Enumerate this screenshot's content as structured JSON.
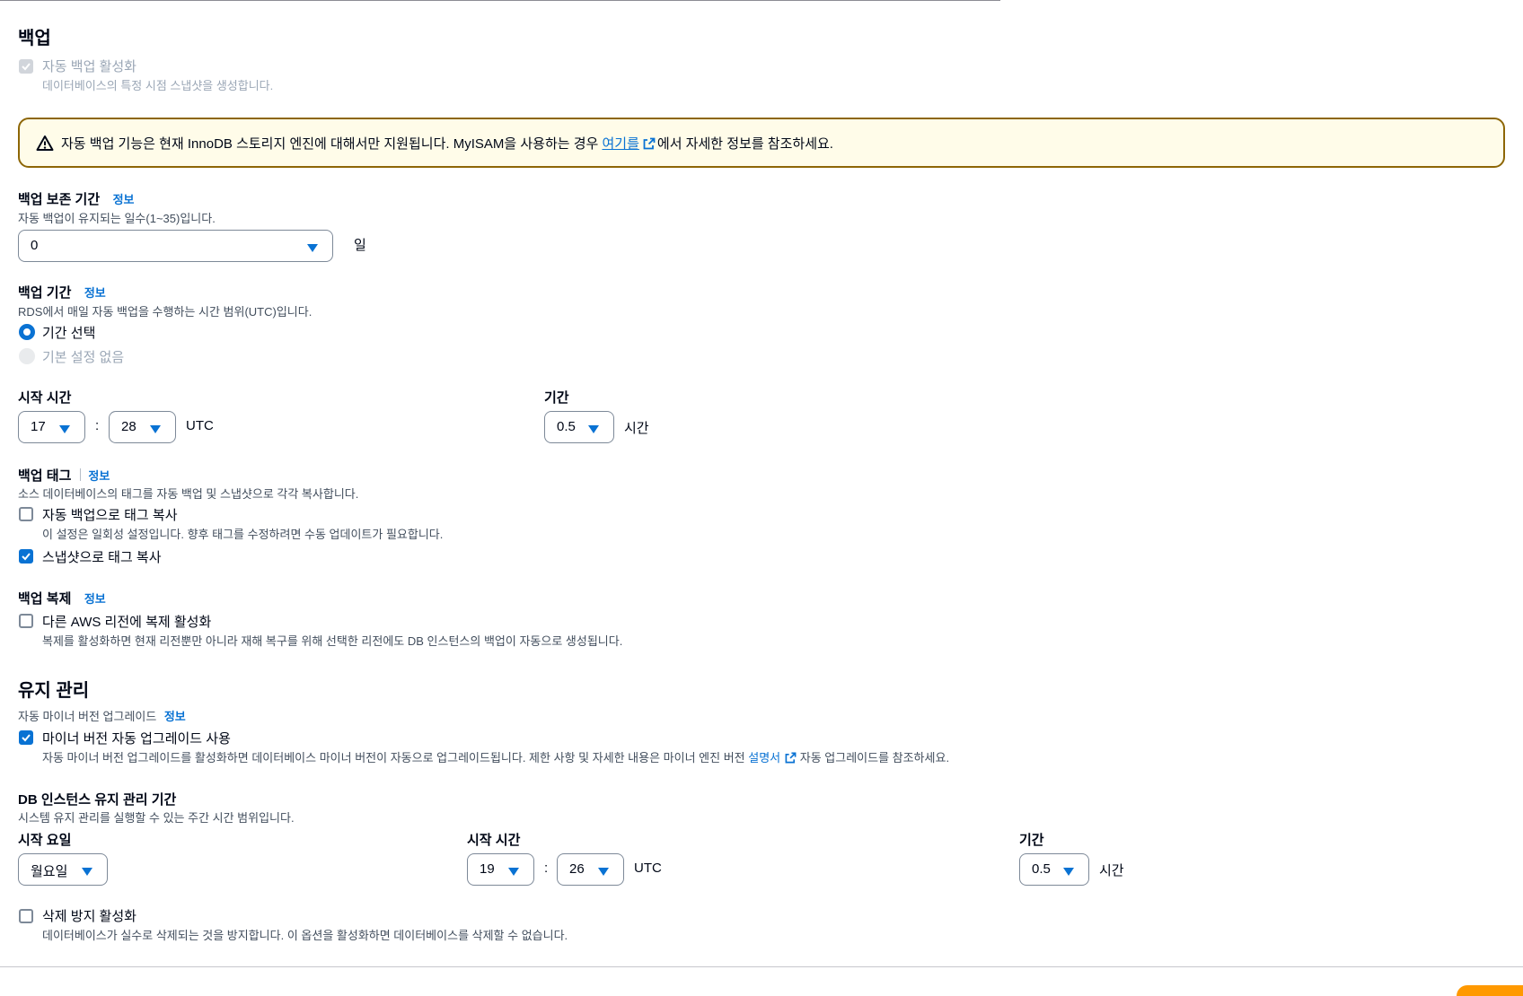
{
  "backup": {
    "title": "백업",
    "auto_backup": {
      "label": "자동 백업 활성화",
      "desc": "데이터베이스의 특정 시점 스냅샷을 생성합니다.",
      "checked": true,
      "disabled": true
    },
    "warning": {
      "text": "자동 백업 기능은 현재 InnoDB 스토리지 엔진에 대해서만 지원됩니다. MyISAM을 사용하는 경우 ",
      "link": "여기를",
      "suffix": "에서 자세한 정보를 참조하세요."
    },
    "retention": {
      "label": "백업 보존 기간",
      "info": "정보",
      "desc": "자동 백업이 유지되는 일수(1~35)입니다.",
      "value": "0",
      "unit": "일"
    },
    "window": {
      "label": "백업 기간",
      "info": "정보",
      "desc": "RDS에서 매일 자동 백업을 수행하는 시간 범위(UTC)입니다.",
      "options": [
        {
          "label": "기간 선택",
          "selected": true,
          "disabled": false
        },
        {
          "label": "기본 설정 없음",
          "selected": false,
          "disabled": true
        }
      ],
      "start_label": "시작 시간",
      "hour": "17",
      "colon": ":",
      "minute": "28",
      "utc": "UTC",
      "duration_label": "기간",
      "duration": "0.5",
      "duration_unit": "시간"
    },
    "tags": {
      "label": "백업 태그",
      "info": "정보",
      "desc": "소스 데이터베이스의 태그를 자동 백업 및 스냅샷으로 각각 복사합니다.",
      "copy_to_backups": {
        "label": "자동 백업으로 태그 복사",
        "desc": "이 설정은 일회성 설정입니다. 향후 태그를 수정하려면 수동 업데이트가 필요합니다.",
        "checked": false
      },
      "copy_to_snapshots": {
        "label": "스냅샷으로 태그 복사",
        "checked": true
      }
    },
    "replication": {
      "label": "백업 복제",
      "info": "정보",
      "enable": {
        "label": "다른 AWS 리전에 복제 활성화",
        "desc": "복제를 활성화하면 현재 리전뿐만 아니라 재해 복구를 위해 선택한 리전에도 DB 인스턴스의 백업이 자동으로 생성됩니다.",
        "checked": false
      }
    }
  },
  "maintenance": {
    "title": "유지 관리",
    "auto_minor": {
      "label": "자동 마이너 버전 업그레이드",
      "info": "정보",
      "checkbox_label": "마이너 버전 자동 업그레이드 사용",
      "desc_prefix": "자동 마이너 버전 업그레이드를 활성화하면 데이터베이스 마이너 버전이 자동으로 업그레이드됩니다. 제한 사항 및 자세한 내용은 마이너 엔진 버전 ",
      "desc_link": "설명서",
      "desc_suffix": " 자동 업그레이드를 참조하세요.",
      "checked": true
    },
    "window": {
      "label": "DB 인스턴스 유지 관리 기간",
      "desc": "시스템 유지 관리를 실행할 수 있는 주간 시간 범위입니다.",
      "day_label": "시작 요일",
      "day": "월요일",
      "start_label": "시작 시간",
      "hour": "19",
      "colon": ":",
      "minute": "26",
      "utc": "UTC",
      "duration_label": "기간",
      "duration": "0.5",
      "duration_unit": "시간"
    },
    "deletion_protection": {
      "label": "삭제 방지 활성화",
      "desc": "데이터베이스가 실수로 삭제되는 것을 방지합니다. 이 옵션을 활성화하면 데이터베이스를 삭제할 수 없습니다.",
      "checked": false
    }
  },
  "colors": {
    "accent": "#0972d3",
    "warning_border": "#8d6605",
    "warning_bg": "#fffce9",
    "primary_button": "#ff9900"
  },
  "icons": {
    "warning": "warning-triangle-icon",
    "external": "external-link-icon",
    "caret": "caret-down-icon",
    "check": "check-icon"
  }
}
